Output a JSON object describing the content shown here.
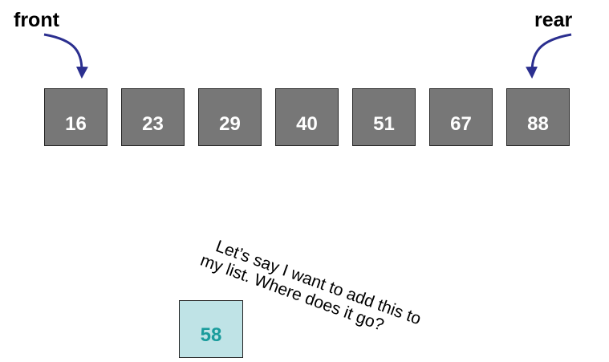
{
  "labels": {
    "front": "front",
    "rear": "rear"
  },
  "queue": [
    "16",
    "23",
    "29",
    "40",
    "51",
    "67",
    "88"
  ],
  "caption": {
    "line1": "Let’s say I want to add this to",
    "line2": "my list. Where does it go?"
  },
  "new_item": "58",
  "colors": {
    "arrow": "#2b2f8f",
    "cell_fill": "#777777",
    "new_item_fill": "#bfe3e6",
    "new_item_text": "#1a9c9c"
  }
}
